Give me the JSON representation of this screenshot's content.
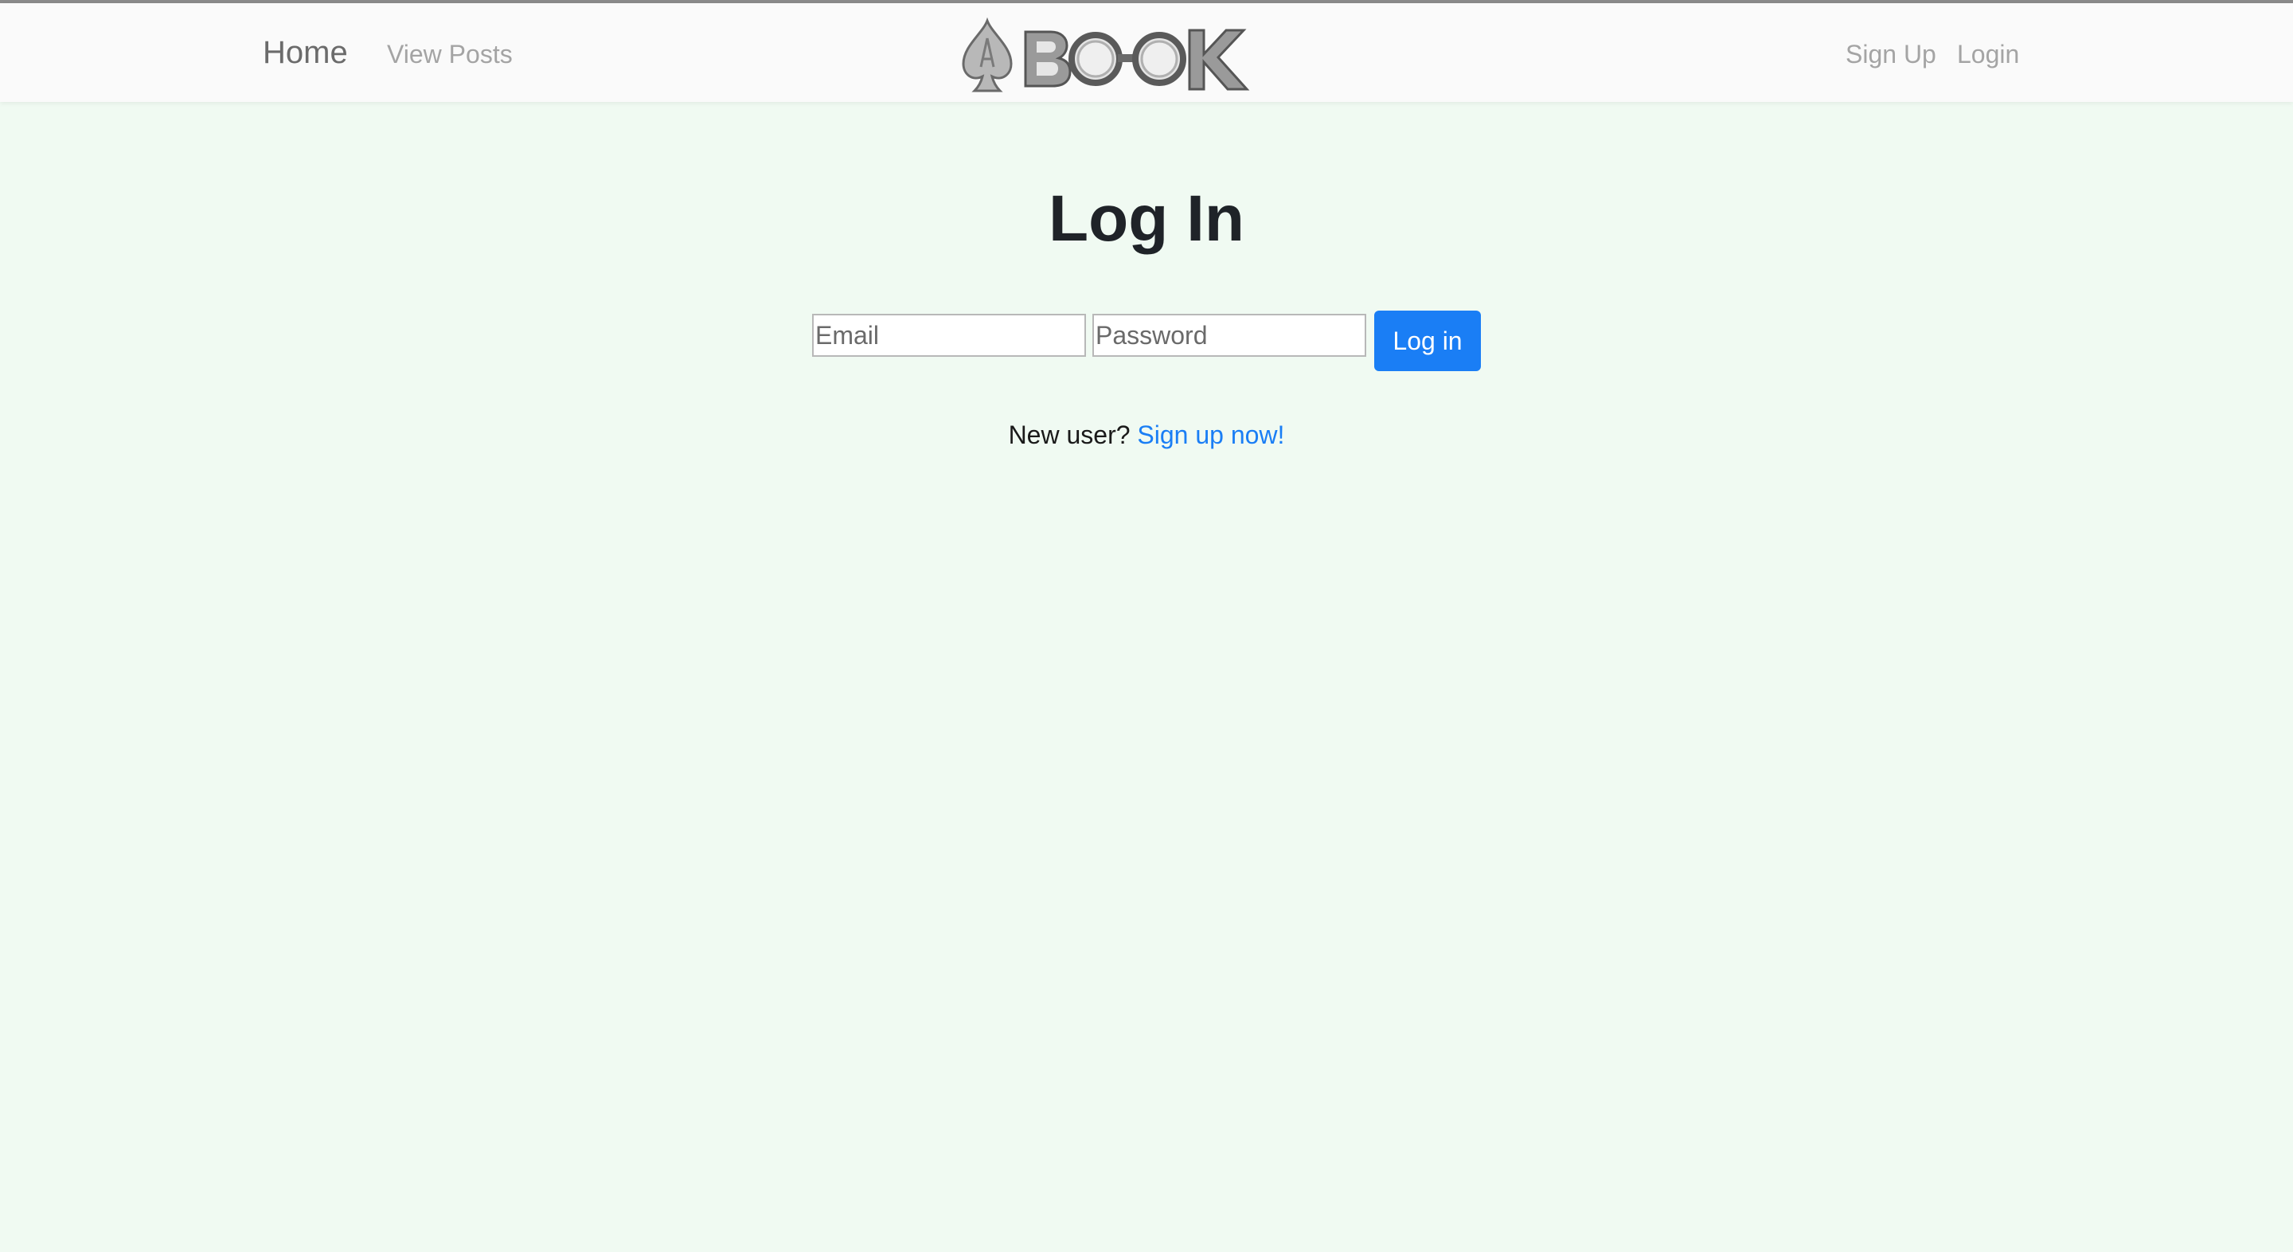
{
  "nav": {
    "home_label": "Home",
    "view_posts_label": "View Posts",
    "signup_label": "Sign Up",
    "login_label": "Login",
    "logo_icon": "spade-book-glasses-logo"
  },
  "login": {
    "title": "Log In",
    "email_placeholder": "Email",
    "email_value": "",
    "password_placeholder": "Password",
    "password_value": "",
    "submit_label": "Log in"
  },
  "signup_prompt": {
    "text": "New user?",
    "link_label": "Sign up now!"
  },
  "colors": {
    "page_background": "#f0faf2",
    "navbar_background": "#fafafa",
    "accent": "#1a7ef5",
    "heading": "#1f2328",
    "nav_text": "#a4a4a4"
  }
}
